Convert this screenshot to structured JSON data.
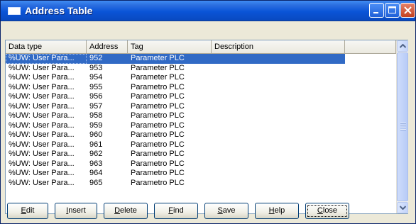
{
  "window": {
    "title": "Address Table"
  },
  "table": {
    "columns": [
      "Data type",
      "Address",
      "Tag",
      "Description"
    ],
    "rows": [
      {
        "data_type": "%UW: User Para...",
        "address": "952",
        "tag": "Parameter PLC",
        "description": "",
        "selected": true
      },
      {
        "data_type": "%UW: User Para...",
        "address": "953",
        "tag": "Parameter PLC",
        "description": ""
      },
      {
        "data_type": "%UW: User Para...",
        "address": "954",
        "tag": "Parameter PLC",
        "description": ""
      },
      {
        "data_type": "%UW: User Para...",
        "address": "955",
        "tag": "Parametro PLC",
        "description": ""
      },
      {
        "data_type": "%UW: User Para...",
        "address": "956",
        "tag": "Parametro PLC",
        "description": ""
      },
      {
        "data_type": "%UW: User Para...",
        "address": "957",
        "tag": "Parametro PLC",
        "description": ""
      },
      {
        "data_type": "%UW: User Para...",
        "address": "958",
        "tag": "Parametro PLC",
        "description": ""
      },
      {
        "data_type": "%UW: User Para...",
        "address": "959",
        "tag": "Parametro PLC",
        "description": ""
      },
      {
        "data_type": "%UW: User Para...",
        "address": "960",
        "tag": "Parametro PLC",
        "description": ""
      },
      {
        "data_type": "%UW: User Para...",
        "address": "961",
        "tag": "Parametro PLC",
        "description": ""
      },
      {
        "data_type": "%UW: User Para...",
        "address": "962",
        "tag": "Parametro PLC",
        "description": ""
      },
      {
        "data_type": "%UW: User Para...",
        "address": "963",
        "tag": "Parametro PLC",
        "description": ""
      },
      {
        "data_type": "%UW: User Para...",
        "address": "964",
        "tag": "Parametro PLC",
        "description": ""
      },
      {
        "data_type": "%UW: User Para...",
        "address": "965",
        "tag": "Parametro PLC",
        "description": ""
      }
    ]
  },
  "buttons": {
    "edit": {
      "hotkey": "E",
      "rest": "dit"
    },
    "insert": {
      "hotkey": "I",
      "rest": "nsert"
    },
    "delete": {
      "hotkey": "D",
      "rest": "elete"
    },
    "find": {
      "hotkey": "F",
      "rest": "ind"
    },
    "save": {
      "hotkey": "S",
      "rest": "ave"
    },
    "help": {
      "hotkey": "H",
      "rest": "elp"
    },
    "close": {
      "hotkey": "C",
      "rest": "lose"
    }
  },
  "colors": {
    "selection": "#316ac5",
    "titlebar": "#0a54d7",
    "face": "#ece9d8"
  }
}
